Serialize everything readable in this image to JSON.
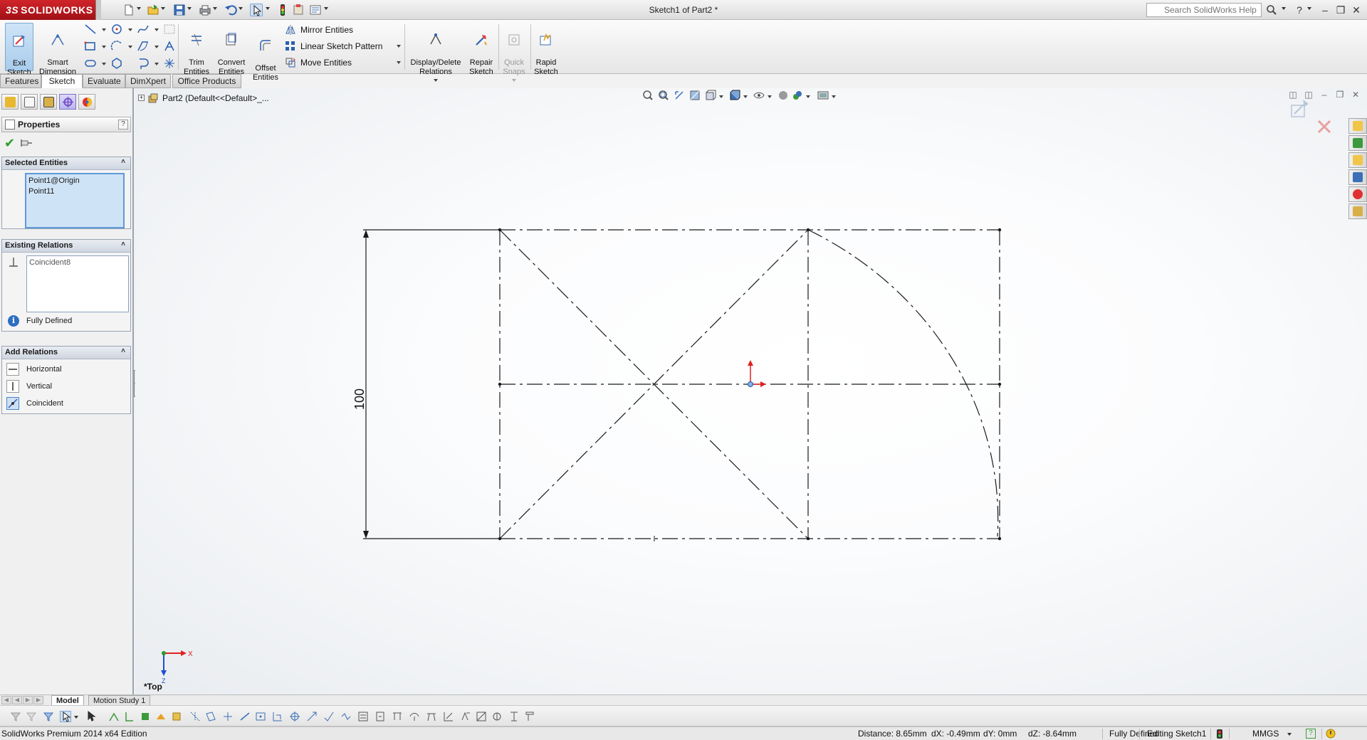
{
  "app": {
    "logo_text": "SOLIDWORKS",
    "logo_prefix": "3S",
    "document_title": "Sketch1 of Part2 *"
  },
  "search": {
    "placeholder": "Search SolidWorks Help"
  },
  "command_manager": {
    "exit_sketch": "Exit\nSketch",
    "smart_dimension": "Smart\nDimension",
    "trim_entities": "Trim\nEntities",
    "convert_entities": "Convert\nEntities",
    "offset_entities": "Offset\nEntities",
    "mirror_entities": "Mirror Entities",
    "linear_sketch_pattern": "Linear Sketch Pattern",
    "move_entities": "Move Entities",
    "display_delete_relations": "Display/Delete\nRelations",
    "repair_sketch": "Repair\nSketch",
    "quick_snaps": "Quick\nSnaps",
    "rapid_sketch": "Rapid\nSketch"
  },
  "cm_tabs": [
    "Features",
    "Sketch",
    "Evaluate",
    "DimXpert",
    "Office Products"
  ],
  "active_cm_tab": "Sketch",
  "property_manager": {
    "title": "Properties",
    "help": "?",
    "selected_entities": {
      "title": "Selected Entities",
      "items": [
        "Point1@Origin",
        "Point11"
      ]
    },
    "existing_relations": {
      "title": "Existing Relations",
      "items": [
        "Coincident8"
      ],
      "status": "Fully Defined"
    },
    "add_relations": {
      "title": "Add Relations",
      "items": [
        "Horizontal",
        "Vertical",
        "Coincident"
      ]
    }
  },
  "tree_flyout": {
    "label": "Part2  (Default<<Default>_..."
  },
  "sketch": {
    "dimension_text": "100",
    "view_name": "*Top",
    "triad_x": "X",
    "triad_z": "Z"
  },
  "model_tabs": [
    "Model",
    "Motion Study 1"
  ],
  "status_bar": {
    "edition": "SolidWorks Premium 2014 x64 Edition",
    "distance": "Distance: 8.65mm",
    "dx": "dX: -0.49mm",
    "dy": "dY: 0mm",
    "dz": "dZ: -8.64mm",
    "sketch_status": "Fully Defined",
    "editing": "Editing Sketch1",
    "units": "MMGS",
    "help_icon": "?"
  },
  "colors": {
    "brand_red": "#c0161c",
    "origin_red": "#e02020",
    "selection_blue": "#cfe3f6",
    "sketch_line": "#1a1a1a"
  }
}
